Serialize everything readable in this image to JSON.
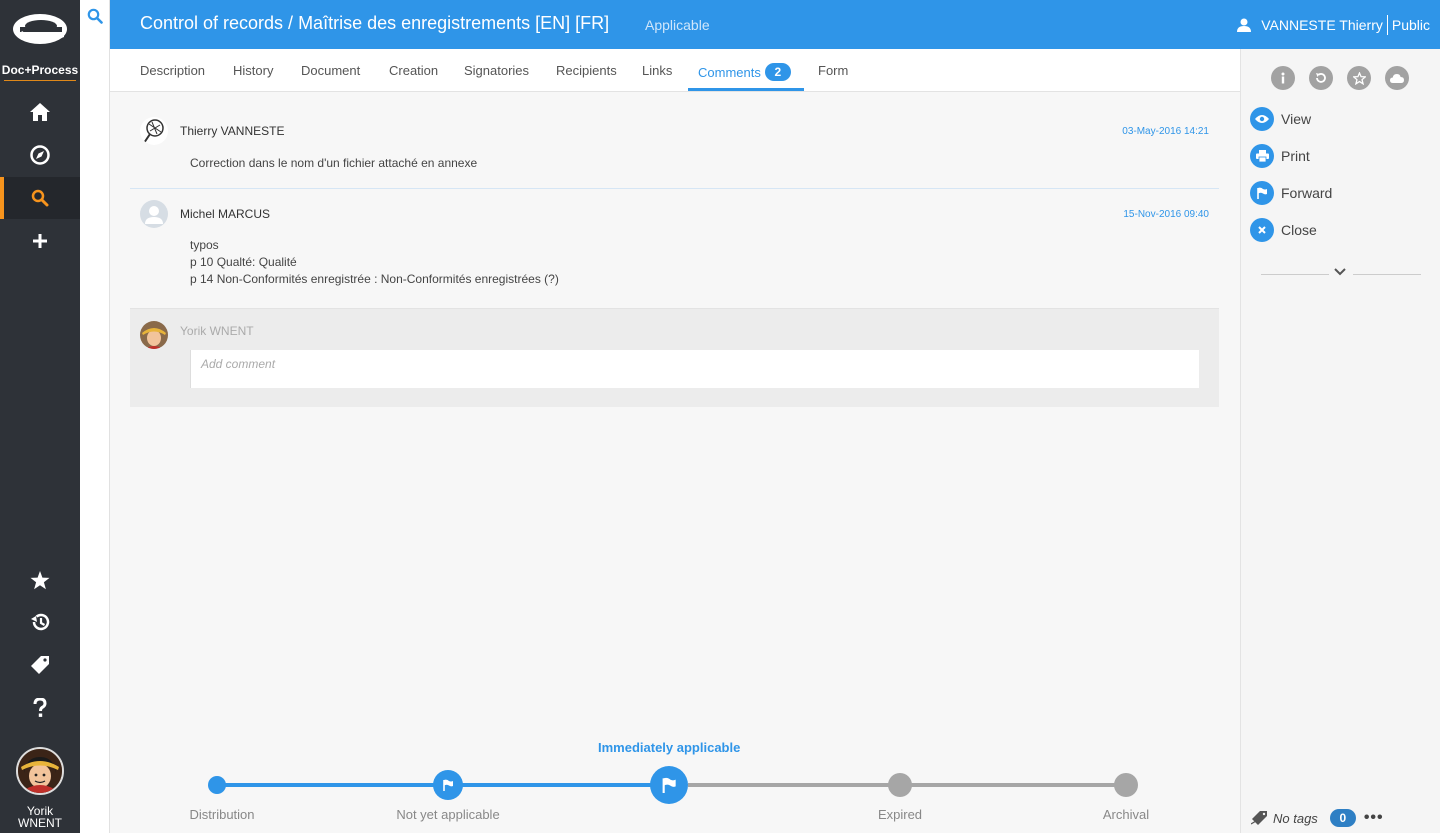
{
  "app": {
    "name": "Doc+Process"
  },
  "sidebar": {
    "top_items": [
      {
        "icon": "home-icon",
        "active": false
      },
      {
        "icon": "compass-icon",
        "active": false
      },
      {
        "icon": "search-icon",
        "active": true
      },
      {
        "icon": "plus-icon",
        "active": false
      }
    ],
    "bottom_items": [
      {
        "icon": "star-icon"
      },
      {
        "icon": "history-icon"
      },
      {
        "icon": "tag-icon"
      },
      {
        "icon": "help-icon"
      }
    ],
    "user": {
      "first_name": "Yorik",
      "last_name": "WNENT"
    }
  },
  "header": {
    "title": "Control of records / Maîtrise des enregistrements [EN] [FR]",
    "status": "Applicable",
    "user_name": "VANNESTE Thierry",
    "visibility": "Public"
  },
  "tabs": [
    {
      "label": "Description"
    },
    {
      "label": "History"
    },
    {
      "label": "Document"
    },
    {
      "label": "Creation"
    },
    {
      "label": "Signatories"
    },
    {
      "label": "Recipients"
    },
    {
      "label": "Links"
    },
    {
      "label": "Comments",
      "badge": "2",
      "active": true
    },
    {
      "label": "Form"
    }
  ],
  "comments": [
    {
      "author": "Thierry VANNESTE",
      "date": "03-May-2016 14:21",
      "lines": [
        "Correction dans le nom d'un fichier attaché en annexe"
      ]
    },
    {
      "author": "Michel MARCUS",
      "date": "15-Nov-2016 09:40",
      "lines": [
        "typos",
        "p 10 Qualté: Qualité",
        "p 14 Non-Conformités enregistrée : Non-Conformités enregistrées (?)"
      ]
    }
  ],
  "new_comment": {
    "author": "Yorik WNENT",
    "placeholder": "Add comment"
  },
  "lifecycle": {
    "current_label": "Immediately applicable",
    "steps": [
      {
        "label": "Distribution",
        "state": "done"
      },
      {
        "label": "Not yet applicable",
        "state": "done"
      },
      {
        "label": "",
        "state": "current"
      },
      {
        "label": "Expired",
        "state": "pending"
      },
      {
        "label": "Archival",
        "state": "pending"
      }
    ],
    "colors": {
      "done": "#2f95e8",
      "pending": "#a6a6a6"
    }
  },
  "right_panel": {
    "top_icons": [
      "info-icon",
      "refresh-icon",
      "star-icon",
      "cloud-icon"
    ],
    "actions": [
      {
        "label": "View",
        "icon": "eye-icon"
      },
      {
        "label": "Print",
        "icon": "print-icon"
      },
      {
        "label": "Forward",
        "icon": "flag-icon"
      },
      {
        "label": "Close",
        "icon": "close-icon"
      }
    ],
    "tags_label": "No tags",
    "tags_count": "0",
    "more_label": "•••"
  },
  "colors": {
    "accent": "#2f95e8",
    "sidebar_bg": "#2e3238",
    "sidebar_active_marker": "#f7941d"
  }
}
